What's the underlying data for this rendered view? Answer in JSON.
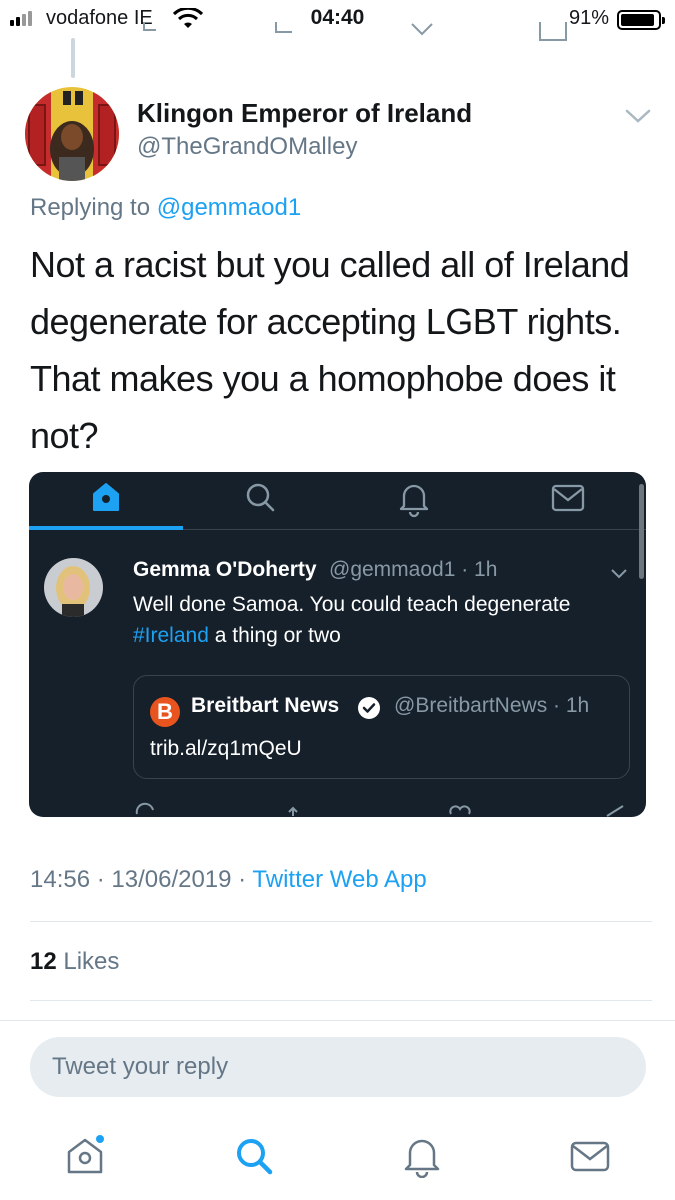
{
  "status_bar": {
    "carrier": "vodafone IE",
    "time": "04:40",
    "battery": "91%",
    "battery_level": 0.91
  },
  "tweet": {
    "author_name": "Klingon Emperor of Ireland",
    "author_handle": "@TheGrandOMalley",
    "replying_prefix": "Replying to",
    "replying_to": "@gemmaod1",
    "text": "Not a racist but you called all of Ireland degenerate for accepting LGBT rights. That makes you a homophobe does it not?",
    "timestamp": "14:56 · 13/06/2019 ·",
    "source": "Twitter Web App",
    "likes_count": "12",
    "likes_label": "Likes"
  },
  "embedded_screenshot": {
    "author_name": "Gemma O'Doherty",
    "author_meta": "@gemmaod1 · 1h",
    "text_before_tag": "Well done Samoa. You could teach degenerate",
    "hashtag": "#Ireland",
    "text_after_tag": "a thing or two",
    "quote": {
      "logo_letter": "B",
      "author_name": "Breitbart News",
      "author_meta": "@BreitbartNews · 1h",
      "link": "trib.al/zq1mQeU"
    },
    "tabs": [
      "home-icon",
      "search-icon",
      "bell-icon",
      "mail-icon"
    ]
  },
  "reply_box": {
    "placeholder": "Tweet your reply"
  },
  "bottom_tabs": [
    "home-icon",
    "search-icon",
    "bell-icon",
    "mail-icon"
  ],
  "colors": {
    "accent": "#1da1f2",
    "secondary_text": "#657786",
    "dark_bg": "#15202b"
  }
}
